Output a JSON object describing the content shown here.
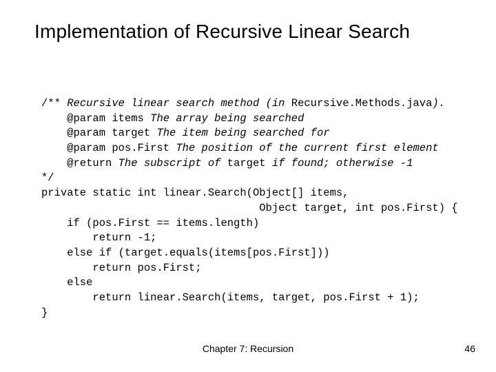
{
  "title": "Implementation of Recursive Linear Search",
  "code": {
    "l01a": "/** ",
    "l01b": "Recursive linear search method (in ",
    "l01c": "Recursive.Methods.java",
    "l01d": ").",
    "l02a": "    @param items ",
    "l02b": "The array being searched",
    "l03a": "    @param target ",
    "l03b": "The item being searched for",
    "l04a": "    @param pos.First ",
    "l04b": "The position of the current first element",
    "l05a": "    @return ",
    "l05b": "The subscript of ",
    "l05c": "target",
    "l05d": " if found; otherwise -1",
    "l06": "*/",
    "l07": "private static int linear.Search(Object[] items,",
    "l08": "                                  Object target, int pos.First) {",
    "l09": "    if (pos.First == items.length)",
    "l10": "        return -1;",
    "l11": "    else if (target.equals(items[pos.First]))",
    "l12": "        return pos.First;",
    "l13": "    else",
    "l14": "        return linear.Search(items, target, pos.First + 1);",
    "l15": "}"
  },
  "footer": {
    "chapter": "Chapter 7: Recursion",
    "page_number": "46"
  }
}
